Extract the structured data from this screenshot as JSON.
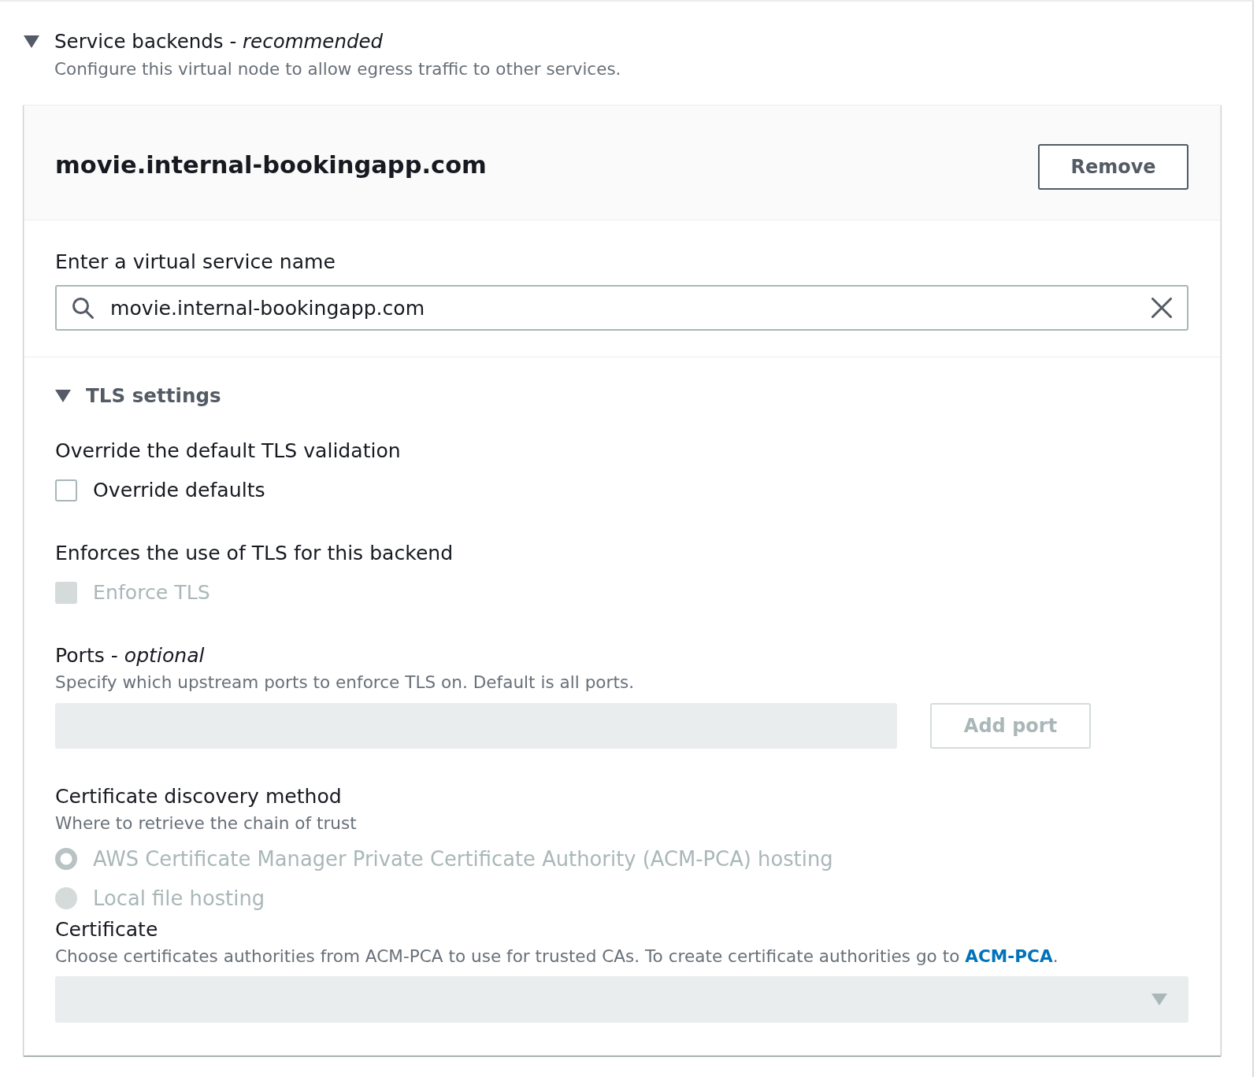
{
  "section": {
    "title": "Service backends - *recommended*",
    "expanded": true,
    "description": "Configure this virtual node to allow egress traffic to other services."
  },
  "backend": {
    "title": "movie.internal-bookingapp.com",
    "remove_button": "Remove",
    "virtual_service": {
      "label": "Enter a virtual service name",
      "value": "movie.internal-bookingapp.com"
    },
    "tls": {
      "title": "TLS settings",
      "expanded": true,
      "override": {
        "label": "Override the default TLS validation",
        "checkbox": {
          "label": "Override defaults",
          "checked": false,
          "disabled": false
        }
      },
      "enforce": {
        "label": "Enforces the use of TLS for this backend",
        "checkbox": {
          "label": "Enforce TLS",
          "checked": false,
          "disabled": true
        }
      },
      "ports": {
        "label": "Ports - *optional*",
        "description": "Specify which upstream ports to enforce TLS on. Default is all ports.",
        "input": {
          "disabled": true
        },
        "add_button": {
          "label": "Add port",
          "disabled": true
        }
      },
      "discovery": {
        "label": "Certificate discovery method",
        "description": "Where to retrieve the chain of trust",
        "options": [
          {
            "label": "AWS Certificate Manager Private Certificate Authority (ACM-PCA) hosting",
            "selected": true,
            "disabled": true
          },
          {
            "label": "Local file hosting",
            "selected": false,
            "disabled": true
          }
        ]
      },
      "certificate": {
        "label": "Certificate",
        "description": {
          "text": "Choose certificates authorities from ACM-PCA to use for trusted CAs. To create certificate authorities go to ",
          "link": "ACM-PCA",
          "suffix": "."
        },
        "select": {
          "disabled": true
        }
      }
    }
  }
}
